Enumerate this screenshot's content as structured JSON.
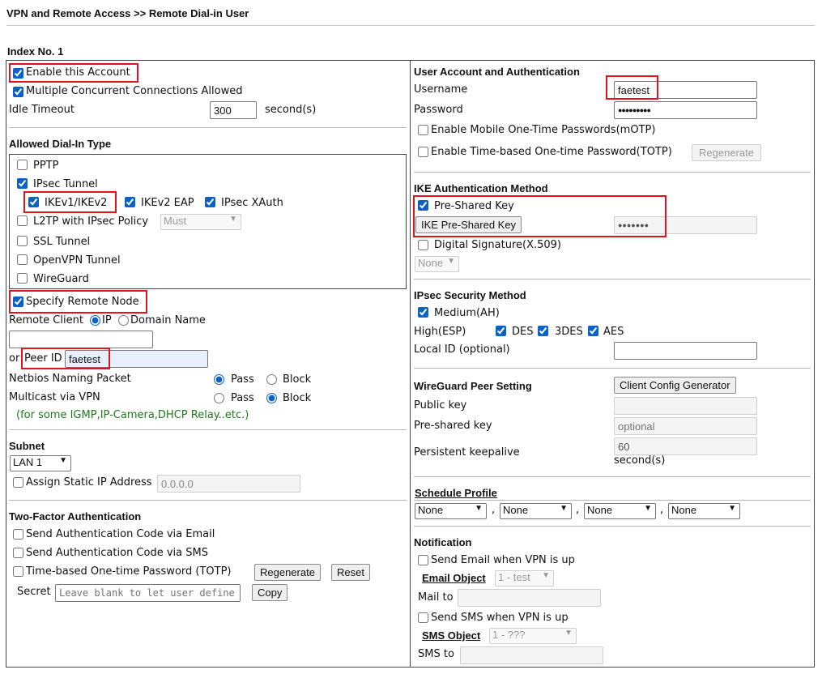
{
  "page_title": "VPN and Remote Access >> Remote Dial-in User",
  "index_label": "Index No. 1",
  "left": {
    "enable_account": "Enable this Account",
    "multiple_connections": "Multiple Concurrent Connections Allowed",
    "idle_timeout_label": "Idle Timeout",
    "idle_timeout_value": "300",
    "idle_timeout_unit": "second(s)",
    "dialin_title": "Allowed Dial-In Type",
    "pptp": "PPTP",
    "ipsec_tunnel": "IPsec Tunnel",
    "ikev1_ikev2": "IKEv1/IKEv2",
    "ikev2_eap": "IKEv2 EAP",
    "ipsec_xauth": "IPsec XAuth",
    "l2tp": "L2TP with IPsec Policy",
    "l2tp_policy": "Must",
    "ssl_tunnel": "SSL Tunnel",
    "openvpn": "OpenVPN Tunnel",
    "wireguard": "WireGuard",
    "specify_remote": "Specify Remote Node",
    "remote_client": "Remote Client",
    "ip": "IP",
    "domain_name": "Domain Name",
    "or": "or",
    "peer_id_label": "Peer ID",
    "peer_id_value": "faetest",
    "netbios": "Netbios Naming Packet",
    "multicast": "Multicast via VPN",
    "pass": "Pass",
    "block": "Block",
    "multicast_note": "(for some IGMP,IP-Camera,DHCP Relay..etc.)",
    "subnet_title": "Subnet",
    "subnet_value": "LAN 1",
    "assign_static": "Assign Static IP Address",
    "static_ip": "0.0.0.0",
    "twofa_title": "Two-Factor Authentication",
    "send_email_code": "Send Authentication Code via Email",
    "send_sms_code": "Send Authentication Code via SMS",
    "totp": "Time-based One-time Password (TOTP)",
    "regenerate": "Regenerate",
    "reset": "Reset",
    "secret_label": "Secret",
    "secret_placeholder": "Leave blank to let user define",
    "copy": "Copy"
  },
  "right": {
    "account_title": "User Account and Authentication",
    "username_label": "Username",
    "username_value": "faetest",
    "password_label": "Password",
    "password_value": "●●●●●●●●●",
    "mobile_otp": "Enable Mobile One-Time Passwords(mOTP)",
    "totp": "Enable Time-based One-time Password(TOTP)",
    "regenerate": "Regenerate",
    "ike_title": "IKE Authentication Method",
    "psk": "Pre-Shared Key",
    "ike_psk_button": "IKE Pre-Shared Key",
    "ike_psk_value": "●●●●●●●",
    "digital_sig": "Digital Signature(X.509)",
    "digital_sig_select": "None",
    "ipsec_title": "IPsec Security Method",
    "medium_ah": "Medium(AH)",
    "high_esp": "High(ESP)",
    "des": "DES",
    "3des": "3DES",
    "aes": "AES",
    "local_id": "Local ID (optional)",
    "wg_title": "WireGuard Peer Setting",
    "client_config": "Client Config Generator",
    "public_key": "Public key",
    "preshared_key": "Pre-shared key",
    "preshared_placeholder": "optional",
    "keepalive": "Persistent keepalive",
    "keepalive_value": "60",
    "keepalive_unit": "second(s)",
    "schedule_title": "Schedule Profile",
    "schedule_values": [
      "None",
      "None",
      "None",
      "None"
    ],
    "comma": ",",
    "notification_title": "Notification",
    "send_email_up": "Send Email when VPN is up",
    "email_object": "Email Object",
    "email_object_value": "1 - test",
    "mail_to": "Mail to",
    "send_sms_up": "Send SMS when VPN is up",
    "sms_object": "SMS Object",
    "sms_object_value": "1 - ???",
    "sms_to": "SMS to"
  }
}
